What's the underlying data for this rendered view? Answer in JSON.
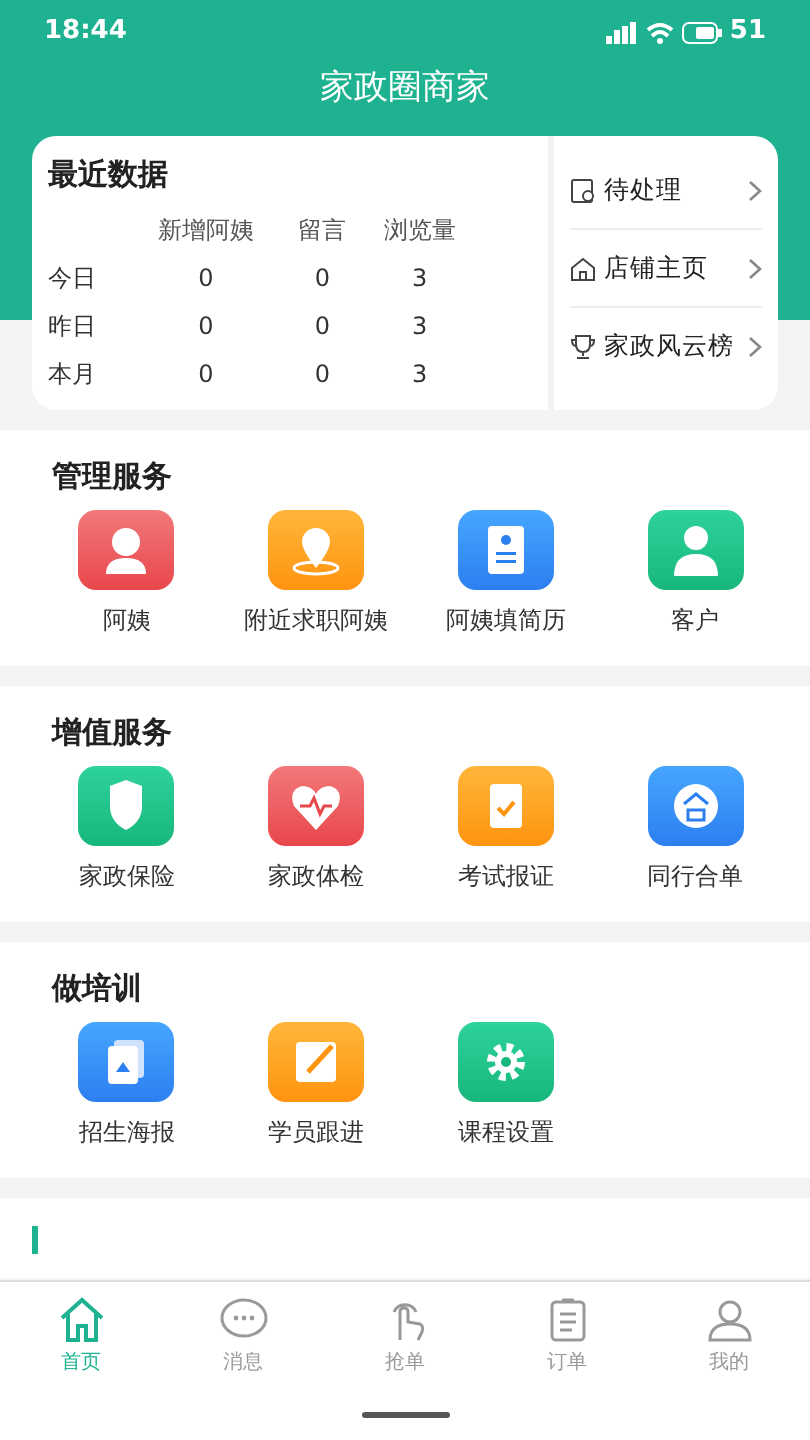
{
  "status_bar": {
    "time": "18:44",
    "battery": "51"
  },
  "header": {
    "title": "家政圈商家"
  },
  "recent_data": {
    "title": "最近数据",
    "columns": [
      "新增阿姨",
      "留言",
      "浏览量"
    ],
    "rows": [
      {
        "label": "今日",
        "values": [
          "0",
          "0",
          "3"
        ]
      },
      {
        "label": "昨日",
        "values": [
          "0",
          "0",
          "3"
        ]
      },
      {
        "label": "本月",
        "values": [
          "0",
          "0",
          "3"
        ]
      }
    ],
    "links": [
      "待处理",
      "店铺主页",
      "家政风云榜"
    ]
  },
  "sections": [
    {
      "title": "管理服务",
      "items": [
        "阿姨",
        "附近求职阿姨",
        "阿姨填简历",
        "客户"
      ]
    },
    {
      "title": "增值服务",
      "items": [
        "家政保险",
        "家政体检",
        "考试报证",
        "同行合单"
      ]
    },
    {
      "title": "做培训",
      "items": [
        "招生海报",
        "学员跟进",
        "课程设置"
      ]
    }
  ],
  "tab_bar": [
    {
      "label": "首页",
      "selected": true
    },
    {
      "label": "消息",
      "selected": false
    },
    {
      "label": "抢单",
      "selected": false
    },
    {
      "label": "订单",
      "selected": false
    },
    {
      "label": "我的",
      "selected": false
    }
  ]
}
